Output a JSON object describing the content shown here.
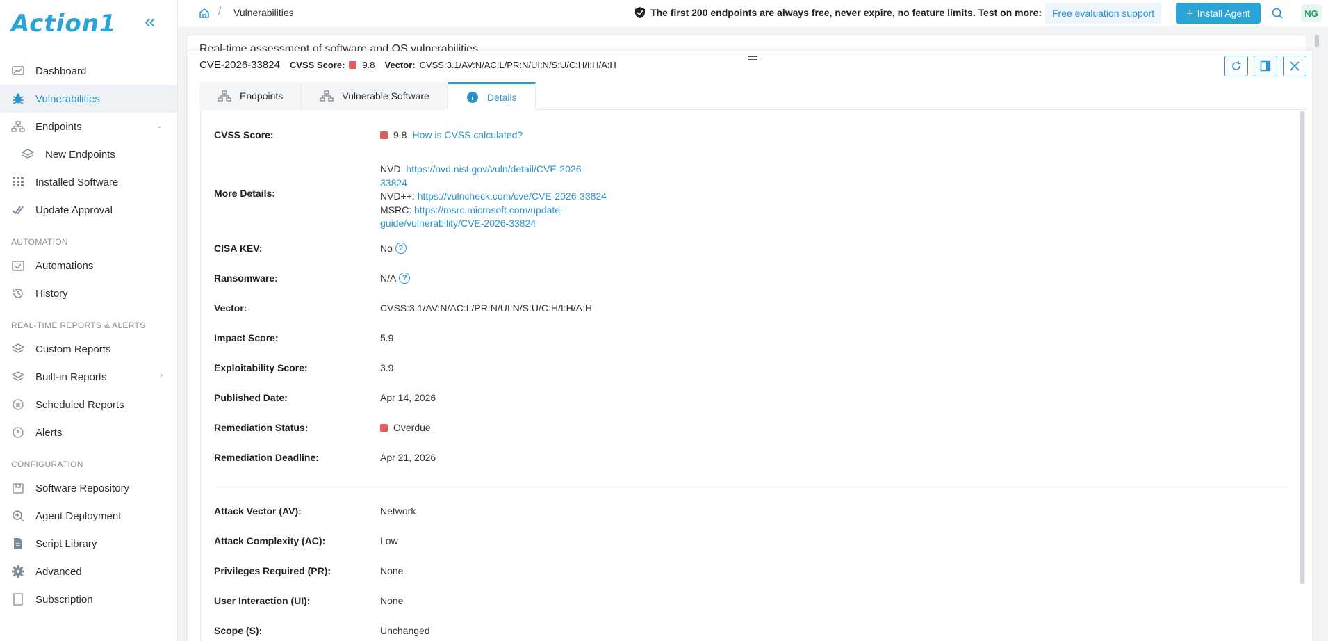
{
  "brand": {
    "name": "Action1",
    "accent": "#2aa3d6"
  },
  "sidebar": {
    "items": [
      {
        "id": "dashboard",
        "label": "Dashboard"
      },
      {
        "id": "vulnerabilities",
        "label": "Vulnerabilities",
        "active": true
      },
      {
        "id": "endpoints",
        "label": "Endpoints"
      },
      {
        "id": "new-endpoints",
        "label": "New Endpoints"
      },
      {
        "id": "installed-software",
        "label": "Installed Software"
      },
      {
        "id": "update-approval",
        "label": "Update Approval"
      }
    ],
    "section_automation": "AUTOMATION",
    "automation_items": [
      {
        "id": "automations",
        "label": "Automations"
      },
      {
        "id": "history",
        "label": "History"
      }
    ],
    "section_reports": "REAL-TIME REPORTS & ALERTS",
    "report_items": [
      {
        "id": "custom-reports",
        "label": "Custom Reports"
      },
      {
        "id": "built-in-reports",
        "label": "Built-in Reports"
      },
      {
        "id": "scheduled-reports",
        "label": "Scheduled Reports"
      },
      {
        "id": "alerts",
        "label": "Alerts"
      }
    ],
    "section_config": "CONFIGURATION",
    "config_items": [
      {
        "id": "software-repository",
        "label": "Software Repository"
      },
      {
        "id": "agent-deployment",
        "label": "Agent Deployment"
      },
      {
        "id": "script-library",
        "label": "Script Library"
      },
      {
        "id": "advanced",
        "label": "Advanced"
      },
      {
        "id": "subscription",
        "label": "Subscription"
      }
    ]
  },
  "topbar": {
    "breadcrumb_sep": "/",
    "breadcrumb": "Vulnerabilities",
    "promo": "The first 200 endpoints are always free, never expire, no feature limits. Test on more:",
    "eval_label": "Free evaluation support",
    "install_label": "Install Agent",
    "avatar": "NG"
  },
  "page": {
    "title": "Real-time assessment of software and OS vulnerabilities"
  },
  "drawer": {
    "cve": "CVE-2026-33824",
    "cvss_label": "CVSS Score:",
    "cvss_value": "9.8",
    "vector_label": "Vector:",
    "vector_value": "CVSS:3.1/AV:N/AC:L/PR:N/UI:N/S:U/C:H/I:H/A:H",
    "tabs": [
      {
        "id": "endpoints",
        "label": "Endpoints"
      },
      {
        "id": "vulnerable-software",
        "label": "Vulnerable Software"
      },
      {
        "id": "details",
        "label": "Details",
        "active": true
      }
    ]
  },
  "details": {
    "cvss_label": "CVSS Score:",
    "cvss_value": "9.8",
    "cvss_link": "How is CVSS calculated?",
    "more_label": "More Details:",
    "nvd_prefix": "NVD: ",
    "nvd_link_1": "https://nvd.nist.gov/vuln/detail/CVE-2026-",
    "nvd_link_2": "33824",
    "nvdpp_prefix": "NVD++: ",
    "nvdpp_link": "https://vulncheck.com/cve/CVE-2026-33824",
    "msrc_prefix": "MSRC: ",
    "msrc_link_1": "https://msrc.microsoft.com/update-",
    "msrc_link_2": "guide/vulnerability/CVE-2026-33824",
    "cisa_label": "CISA KEV:",
    "cisa_value": "No",
    "ransomware_label": "Ransomware:",
    "ransomware_value": "N/A",
    "vector_label": "Vector:",
    "vector_value": "CVSS:3.1/AV:N/AC:L/PR:N/UI:N/S:U/C:H/I:H/A:H",
    "impact_label": "Impact Score:",
    "impact_value": "5.9",
    "exploit_label": "Exploitability Score:",
    "exploit_value": "3.9",
    "published_label": "Published Date:",
    "published_value": "Apr 14, 2026",
    "status_label": "Remediation Status:",
    "status_value": "Overdue",
    "deadline_label": "Remediation Deadline:",
    "deadline_value": "Apr 21, 2026",
    "av_label": "Attack Vector (AV):",
    "av_value": "Network",
    "ac_label": "Attack Complexity (AC):",
    "ac_value": "Low",
    "pr_label": "Privileges Required (PR):",
    "pr_value": "None",
    "ui_label": "User Interaction (UI):",
    "ui_value": "None",
    "scope_label": "Scope (S):",
    "scope_value": "Unchanged"
  },
  "colors": {
    "severity_critical": "#e25c5c",
    "link": "#2a94cf",
    "active_bg": "#eef2f6"
  }
}
